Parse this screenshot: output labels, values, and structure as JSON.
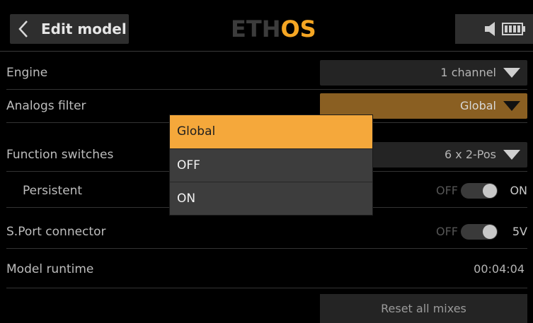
{
  "header": {
    "title": "Edit model",
    "logo_part_a": "ETH",
    "logo_part_b": "OS"
  },
  "rows": [
    {
      "label": "Engine",
      "value": "1 channel"
    },
    {
      "label": "Analogs filter",
      "value": "Global"
    },
    {
      "label": "Function switches",
      "value": "6 x 2-Pos"
    },
    {
      "label": "Persistent",
      "off_label": "OFF",
      "on_label": "ON"
    },
    {
      "label": "S.Port connector",
      "off_label": "OFF",
      "on_label": "5V"
    },
    {
      "label": "Model runtime",
      "value": "00:04:04"
    }
  ],
  "reset_button": "Reset all mixes",
  "popup": {
    "options": [
      "Global",
      "OFF",
      "ON"
    ],
    "selected": "Global"
  },
  "colors": {
    "accent": "#f5a83b",
    "selected_field": "#8a5f22"
  },
  "icons": {
    "back": "chevron-left-icon",
    "speaker": "speaker-icon",
    "battery": "battery-icon",
    "dropdown": "caret-down-icon"
  }
}
